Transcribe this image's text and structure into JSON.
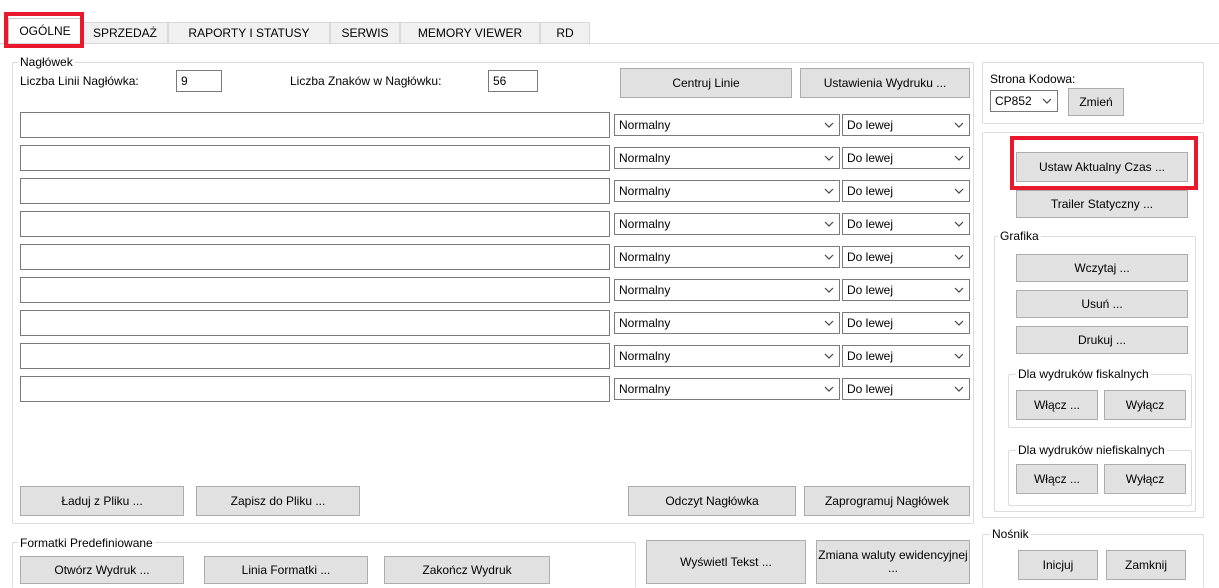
{
  "tabs": [
    {
      "label": "OGÓLNE",
      "active": true
    },
    {
      "label": "SPRZEDAŻ",
      "active": false
    },
    {
      "label": "RAPORTY I STATUSY",
      "active": false
    },
    {
      "label": "SERWIS",
      "active": false
    },
    {
      "label": "MEMORY VIEWER",
      "active": false
    },
    {
      "label": "RD",
      "active": false
    }
  ],
  "header_group": {
    "title": "Nagłówek",
    "line_count_label": "Liczba Linii Nagłówka:",
    "line_count_value": "9",
    "char_count_label": "Liczba Znaków w Nagłówku:",
    "char_count_value": "56",
    "center_button": "Centruj Linie",
    "print_settings_button": "Ustawienia Wydruku ...",
    "rows": [
      {
        "text": "",
        "style": "Normalny",
        "align": "Do lewej"
      },
      {
        "text": "",
        "style": "Normalny",
        "align": "Do lewej"
      },
      {
        "text": "",
        "style": "Normalny",
        "align": "Do lewej"
      },
      {
        "text": "",
        "style": "Normalny",
        "align": "Do lewej"
      },
      {
        "text": "",
        "style": "Normalny",
        "align": "Do lewej"
      },
      {
        "text": "",
        "style": "Normalny",
        "align": "Do lewej"
      },
      {
        "text": "",
        "style": "Normalny",
        "align": "Do lewej"
      },
      {
        "text": "",
        "style": "Normalny",
        "align": "Do lewej"
      },
      {
        "text": "",
        "style": "Normalny",
        "align": "Do lewej"
      }
    ],
    "load_button": "Ładuj z Pliku ...",
    "save_button": "Zapisz do Pliku ...",
    "read_header_button": "Odczyt Nagłówka",
    "program_header_button": "Zaprogramuj Nagłówek"
  },
  "templates_group": {
    "title": "Formatki Predefiniowane",
    "open_button": "Otwórz Wydruk ...",
    "line_button": "Linia Formatki ...",
    "end_button": "Zakończ Wydruk"
  },
  "display_text_button": "Wyświetl Tekst ...",
  "currency_button": "Zmiana waluty ewidencyjnej ...",
  "codepage_group": {
    "title": "Strona Kodowa:",
    "value": "CP852",
    "change_button": "Zmień"
  },
  "right_panel": {
    "set_time_button": "Ustaw Aktualny Czas ...",
    "trailer_button": "Trailer Statyczny ...",
    "graphics": {
      "title": "Grafika",
      "load_button": "Wczytaj ...",
      "delete_button": "Usuń ...",
      "print_button": "Drukuj ...",
      "fiscal": {
        "title": "Dla wydruków fiskalnych",
        "on": "Włącz ...",
        "off": "Wyłącz"
      },
      "nonfiscal": {
        "title": "Dla wydruków niefiskalnych",
        "on": "Włącz ...",
        "off": "Wyłącz"
      }
    }
  },
  "media_group": {
    "title": "Nośnik",
    "init_button": "Inicjuj",
    "close_button": "Zamknij"
  },
  "colors": {
    "highlight": "#e8192c",
    "button_bg": "#e1e1e1",
    "button_border": "#adadad"
  }
}
